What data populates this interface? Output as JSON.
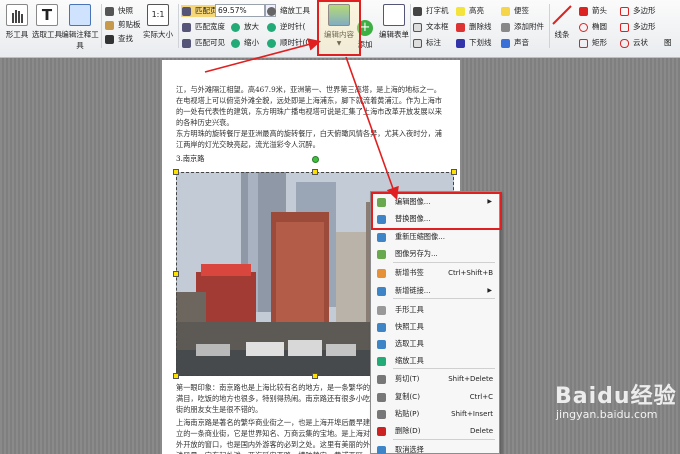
{
  "ribbon": {
    "hand_tool": "形工具",
    "select_tool": "选取工具",
    "annotate_tool": "编辑注释工具",
    "snapshot": "快照",
    "clipboard": "剪贴板",
    "find": "查找",
    "actual_size": "实际大小",
    "fit_page": "匹配页面",
    "fit_width": "匹配宽度",
    "fit_visible": "匹配可见",
    "zoom_value": "69.57%",
    "zoom_tool": "缩放工具",
    "zoom_in": "放大",
    "zoom_out": "缩小",
    "rotate_ccw": "逆时针(",
    "rotate_cw": "顺时针(C",
    "edit_content": "编辑内容",
    "add": "添加",
    "edit_form": "编辑表单",
    "typewriter": "打字机",
    "textbox": "文本框",
    "callout": "标注",
    "highlight": "高亮",
    "strikeout": "删除线",
    "underline": "下划线",
    "note": "便签",
    "attach_file": "添加附件",
    "sound": "声音",
    "line": "线条",
    "arrow": "箭头",
    "ellipse": "椭圆",
    "rectangle": "矩形",
    "polygon": "多边形",
    "polyline": "多边形",
    "cloud": "云状",
    "more": "图"
  },
  "document": {
    "para1": "江，与外滩隔江相望。高467.9米，亚洲第一、世界第三高塔，是上海的地标之一。在电视塔上可以俯览外滩全貌，远处即是上海浦东，脚下就流着黄浦江。作为上海市的一处有代表性的建筑，东方明珠广播电视塔可说是汇集了上海市改革开放发展以来的各种历史兴衰。",
    "para2": "东方明珠的旋转餐厅是亚洲最高的旋转餐厅，白天俯瞰风情各异，尤其入夜时分，浦江两岸的灯光交映亮起，流光溢彩令人沉醉。",
    "heading": "3.南京路",
    "para3": "第一眼印象：南京路也是上海比较有名的地方，是一条繁华的商业街，里面商铺琳琅满目，吃饭的地方也很多，特别得热闹。南京路还有很多小吃，到这里去购物喜欢逛街的朋友女生是很不错的。",
    "para4": "上海南京路是著名的繁华商业街之一，也是上海开埠后最早建立的一条商业街，它是世界知名、万商云集的宝地。是上海对外开放的窗口，也是国内外游客的必到之处。这里有美丽的外滩风景，它东起外滩，西迄延安西路，横跨静安、黄浦两区，全长5300多公里，以西藏中路为界分为东西两段。广义上的南京路也包含南京西路。"
  },
  "context_menu": {
    "items": [
      {
        "label": "编辑图像...",
        "shortcut": "",
        "submenu": true
      },
      {
        "label": "替换图像...",
        "shortcut": "",
        "submenu": false
      },
      {
        "label": "重新压缩图像...",
        "shortcut": "",
        "submenu": false
      },
      {
        "label": "图像另存为...",
        "shortcut": "",
        "submenu": false
      },
      {
        "label": "新增书签",
        "shortcut": "Ctrl+Shift+B",
        "submenu": false
      },
      {
        "label": "新增链接...",
        "shortcut": "",
        "submenu": true
      },
      {
        "label": "手形工具",
        "shortcut": "",
        "submenu": false
      },
      {
        "label": "快照工具",
        "shortcut": "",
        "submenu": false
      },
      {
        "label": "选取工具",
        "shortcut": "",
        "submenu": false
      },
      {
        "label": "缩放工具",
        "shortcut": "",
        "submenu": false
      },
      {
        "label": "剪切(T)",
        "shortcut": "Shift+Delete",
        "submenu": false
      },
      {
        "label": "复制(C)",
        "shortcut": "Ctrl+C",
        "submenu": false
      },
      {
        "label": "粘贴(P)",
        "shortcut": "Shift+Insert",
        "submenu": false
      },
      {
        "label": "删除(D)",
        "shortcut": "Delete",
        "submenu": false
      },
      {
        "label": "取消选择",
        "shortcut": "",
        "submenu": false
      }
    ]
  },
  "watermark": {
    "brand": "Baidu经验",
    "url": "jingyan.baidu.com"
  },
  "colors": {
    "highlight_red": "#e02020",
    "ribbon_bg": "#eceff2"
  }
}
